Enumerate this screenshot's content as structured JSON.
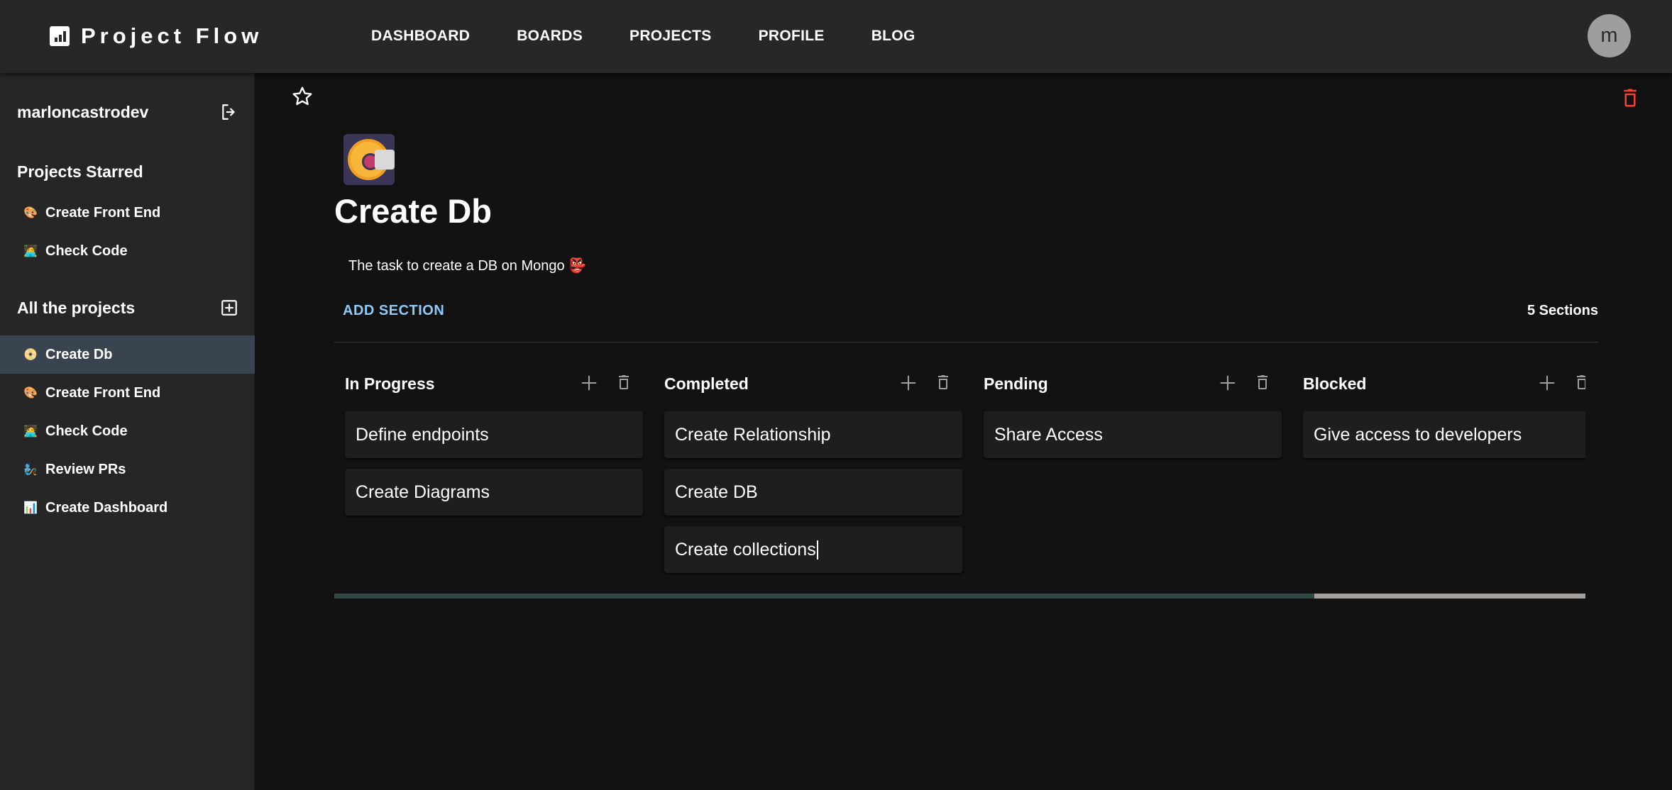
{
  "app": {
    "title": "Project Flow"
  },
  "nav": {
    "items": [
      {
        "label": "DASHBOARD"
      },
      {
        "label": "BOARDS"
      },
      {
        "label": "PROJECTS"
      },
      {
        "label": "PROFILE"
      },
      {
        "label": "BLOG"
      }
    ]
  },
  "user": {
    "avatar_letter": "m",
    "username": "marloncastrodev"
  },
  "sidebar": {
    "starred_title": "Projects Starred",
    "starred": [
      {
        "emoji": "🎨",
        "label": "Create Front End"
      },
      {
        "emoji": "🧑‍💻",
        "label": "Check Code"
      }
    ],
    "all_title": "All the projects",
    "projects": [
      {
        "emoji": "📀",
        "label": "Create Db",
        "active": true
      },
      {
        "emoji": "🎨",
        "label": "Create Front End"
      },
      {
        "emoji": "🧑‍💻",
        "label": "Check Code"
      },
      {
        "emoji": "🧞",
        "label": "Review PRs"
      },
      {
        "emoji": "📊",
        "label": "Create Dashboard"
      }
    ]
  },
  "project": {
    "icon": "disc-drive-icon",
    "title": "Create Db",
    "description": "The task to create a DB on Mongo 👺",
    "add_section_label": "ADD SECTION",
    "sections_count": "5 Sections"
  },
  "board": {
    "columns": [
      {
        "title": "In Progress",
        "cards": [
          "Define endpoints",
          "Create Diagrams"
        ]
      },
      {
        "title": "Completed",
        "cards": [
          "Create Relationship",
          "Create DB",
          "Create collections"
        ]
      },
      {
        "title": "Pending",
        "cards": [
          "Share Access"
        ]
      },
      {
        "title": "Blocked",
        "cards": [
          "Give access to developers"
        ]
      }
    ]
  },
  "colors": {
    "background": "#121212",
    "topbar": "#272727",
    "sidebar": "#262626",
    "active_item": "#3a4350",
    "accent": "#90caf9",
    "danger": "#f44336"
  }
}
